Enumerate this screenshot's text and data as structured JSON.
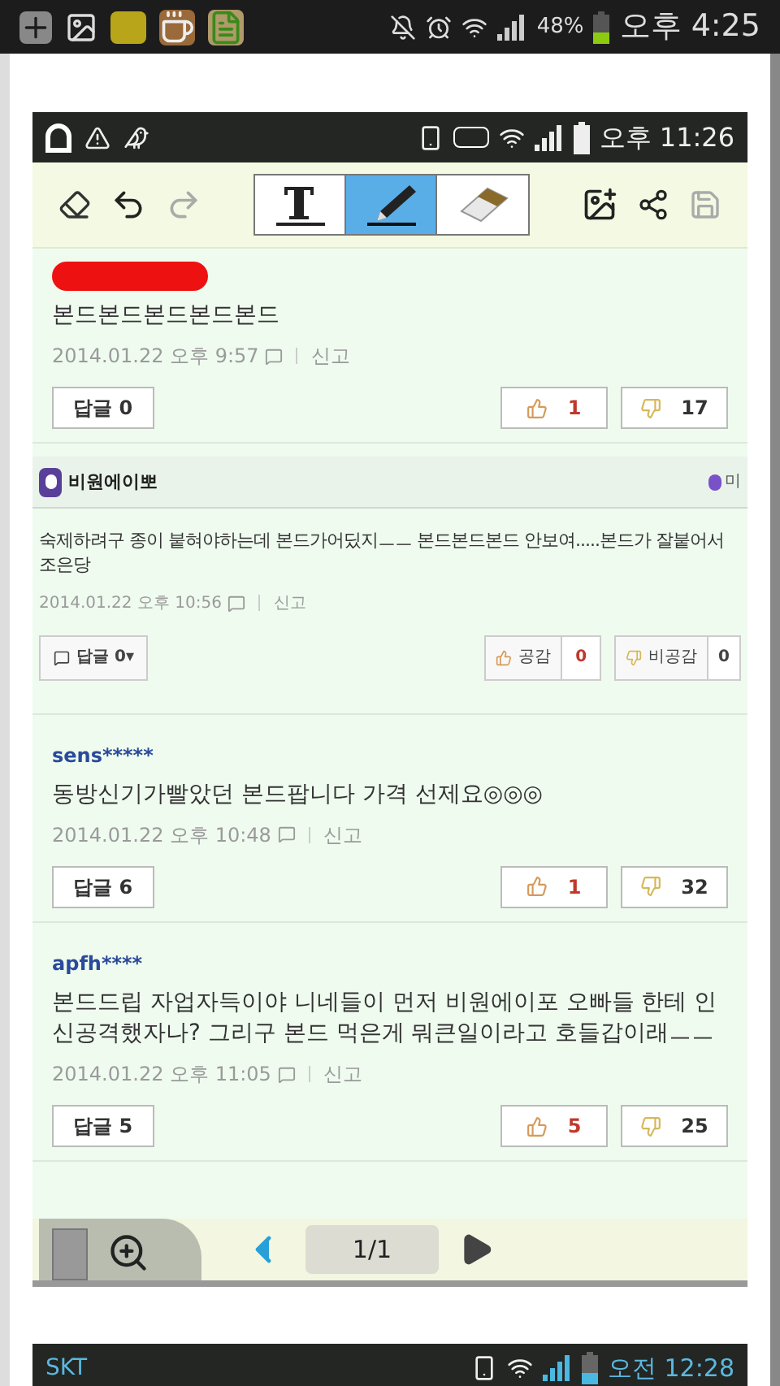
{
  "phone_status_bar": {
    "battery_percent": "48%",
    "time": "오후 4:25"
  },
  "screenshot": {
    "status_bar": {
      "time": "오후 11:26"
    },
    "toolbar": {
      "tools": [
        {
          "kind": "text",
          "selected": false
        },
        {
          "kind": "pen",
          "selected": true
        },
        {
          "kind": "eraser",
          "selected": false
        }
      ]
    },
    "comments": [
      {
        "kind": "simple",
        "redacted": true,
        "text": "본드본드본드본드본드",
        "date": "2014.01.22 오후 9:57",
        "report": "신고",
        "reply": "답글",
        "reply_count": "0",
        "likes": "1",
        "dislikes": "17"
      },
      {
        "kind": "profile",
        "author": "비원에이뽀",
        "badge": "미",
        "text": "숙제하려구 종이 붙혀야하는데 본드가어딨지ㅡㅡ 본드본드본드 안보여.....본드가 잘붙어서 조은당",
        "date": "2014.01.22 오후 10:56",
        "report": "신고",
        "reply": "답글 0▾",
        "agree": "공감",
        "agree_count": "0",
        "disagree": "비공감",
        "disagree_count": "0"
      },
      {
        "kind": "simple",
        "redacted": false,
        "author": "sens*****",
        "text": "동방신기가빨았던 본드팝니다 가격 선제요◎◎◎",
        "date": "2014.01.22 오후 10:48",
        "report": "신고",
        "reply": "답글",
        "reply_count": "6",
        "likes": "1",
        "dislikes": "32"
      },
      {
        "kind": "simple",
        "redacted": false,
        "author": "apfh****",
        "text": "본드드립 자업자득이야 니네들이 먼저 비원에이포 오빠들 한테 인신공격했자나? 그리구 본드 먹은게 뭐큰일이라고 호들갑이래ㅡㅡ",
        "date": "2014.01.22 오후 11:05",
        "report": "신고",
        "reply": "답글",
        "reply_count": "5",
        "likes": "5",
        "dislikes": "25"
      }
    ],
    "pager": {
      "page": "1/1"
    }
  },
  "next_screenshot": {
    "status_bar": {
      "carrier": "SKT",
      "time": "오전 12:28"
    }
  }
}
